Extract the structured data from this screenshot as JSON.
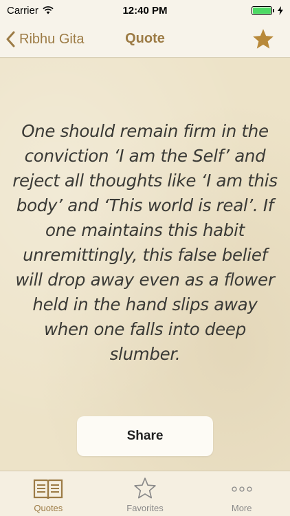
{
  "status": {
    "carrier": "Carrier",
    "time": "12:40 PM"
  },
  "nav": {
    "back_label": "Ribhu Gita",
    "title": "Quote"
  },
  "quote": {
    "text": "One should remain firm in the conviction ‘I am the Self’ and reject all thoughts like ‘I am this body’ and ‘This world is real’. If one maintains this habit unremittingly, this false belief will drop away even as a flower held in the hand slips away when one falls into deep slumber."
  },
  "share": {
    "label": "Share"
  },
  "tabs": [
    {
      "label": "Quotes",
      "icon": "book-icon",
      "active": true
    },
    {
      "label": "Favorites",
      "icon": "star-outline-icon",
      "active": false
    },
    {
      "label": "More",
      "icon": "more-icon",
      "active": false
    }
  ],
  "colors": {
    "accent": "#9c7b45",
    "star": "#b8893a",
    "battery": "#4cd964",
    "background": "#ede3c8"
  }
}
